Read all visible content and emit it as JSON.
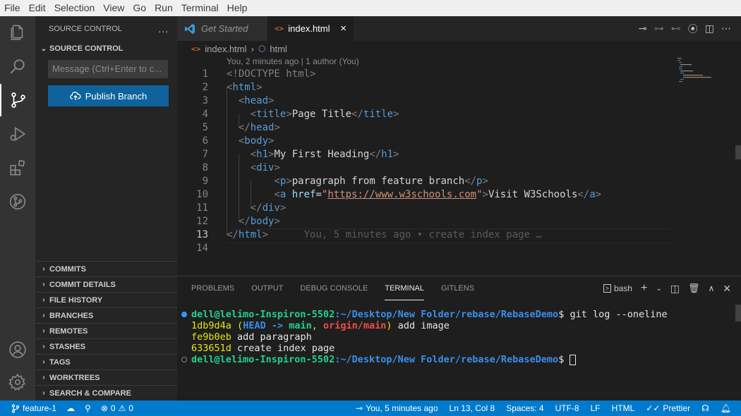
{
  "menubar": [
    "File",
    "Edit",
    "Selection",
    "View",
    "Go",
    "Run",
    "Terminal",
    "Help"
  ],
  "sidebar": {
    "header": "SOURCE CONTROL",
    "more": "...",
    "section_title": "SOURCE CONTROL",
    "message_placeholder": "Message (Ctrl+Enter to c...",
    "publish_label": "Publish Branch",
    "sections": [
      "COMMITS",
      "COMMIT DETAILS",
      "FILE HISTORY",
      "BRANCHES",
      "REMOTES",
      "STASHES",
      "TAGS",
      "WORKTREES",
      "SEARCH & COMPARE"
    ]
  },
  "tabs": {
    "inactive_label": "Get Started",
    "active_label": "index.html",
    "close": "×"
  },
  "breadcrumb": {
    "file": "index.html",
    "element": "html"
  },
  "editor": {
    "blame_header": "You, 2 minutes ago | 1 author (You)",
    "line_numbers": [
      "1",
      "2",
      "3",
      "4",
      "5",
      "6",
      "7",
      "8",
      "9",
      "10",
      "11",
      "12",
      "13",
      "14"
    ],
    "current_line_blame": "You, 5 minutes ago • create index page …",
    "doctype": "<!DOCTYPE html>",
    "t_html": "html",
    "t_head": "head",
    "t_title": "title",
    "t_body": "body",
    "t_h1": "h1",
    "t_div": "div",
    "t_p": "p",
    "t_a": "a",
    "attr_href": "href",
    "title_text": "Page Title",
    "h1_text": "My First Heading",
    "p_text": "paragraph from feature branch",
    "link_url": "https://www.w3schools.com",
    "link_text": "Visit W3Schools"
  },
  "panel": {
    "tabs": [
      "PROBLEMS",
      "OUTPUT",
      "DEBUG CONSOLE",
      "TERMINAL",
      "GITLENS"
    ],
    "active_tab": "TERMINAL",
    "shell": "bash"
  },
  "terminal": {
    "prompt_user": "dell@lelimo-Inspiron-5502",
    "prompt_path": ":~/Desktop/New Folder/rebase/RebaseDemo",
    "prompt_end": "$ ",
    "command": "git log --oneline",
    "commits": [
      {
        "hash": "1db9d4a",
        "head": "HEAD -> ",
        "branch": "main",
        "origin": "origin/main",
        "msg": "add image"
      },
      {
        "hash": "fe9b0eb",
        "msg": "add paragraph"
      },
      {
        "hash": "633651d",
        "msg": "create index page"
      }
    ]
  },
  "statusbar": {
    "branch": "feature-1",
    "errors": "0",
    "warnings": "0",
    "blame": "You, 5 minutes ago",
    "position": "Ln 13, Col 8",
    "spaces": "Spaces: 4",
    "encoding": "UTF-8",
    "eol": "LF",
    "language": "HTML",
    "prettier": "Prettier"
  },
  "colors": {
    "accent": "#007acc",
    "button": "#0e639c",
    "tag": "#569cd6",
    "attr": "#9cdcfe",
    "string": "#ce9178"
  },
  "icons": [
    "explorer-icon",
    "search-icon",
    "source-control-icon",
    "run-debug-icon",
    "extensions-icon",
    "gitlens-icon",
    "account-icon",
    "gear-icon"
  ]
}
